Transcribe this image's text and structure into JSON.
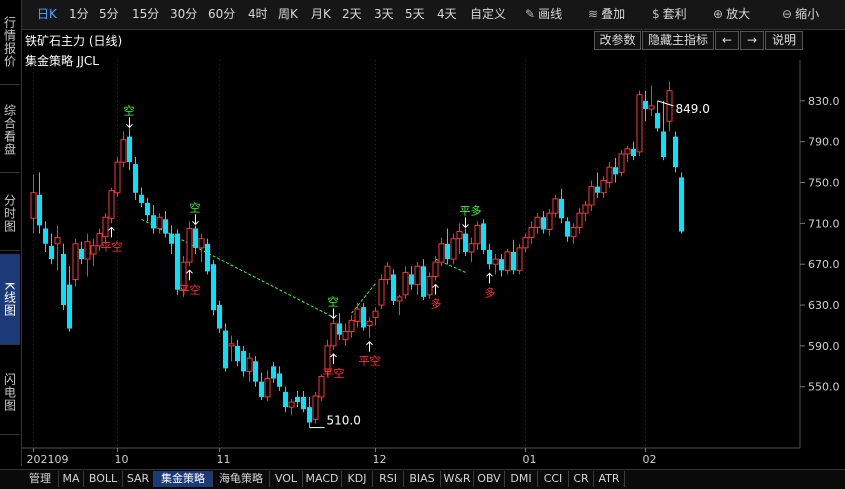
{
  "left_nav": [
    {
      "label": "行情报价",
      "active": false
    },
    {
      "label": "综合看盘",
      "active": false
    },
    {
      "label": "分时图",
      "active": false
    },
    {
      "label": "K线图",
      "active": true
    },
    {
      "label": "闪电图",
      "active": false
    }
  ],
  "toolbar": {
    "periods": [
      "日K",
      "1分",
      "5分",
      "15分",
      "30分",
      "60分",
      "4时",
      "周K",
      "月K",
      "2天",
      "3天",
      "5天",
      "4天",
      "自定义"
    ],
    "active_period": "日K",
    "draw_label": "画线",
    "overlay_label": "叠加",
    "arbitrage_label": "套利",
    "zoom_in_label": "放大",
    "zoom_out_label": "缩小"
  },
  "title": {
    "symbol_name": "铁矿石主力 (日线)",
    "indicator_name": "集金策略 JJCL",
    "change_params": "改参数",
    "hide_main": "隐藏主指标",
    "left_arrow": "←",
    "right_arrow": "→",
    "explain": "说明"
  },
  "bottom_tabs": [
    {
      "label": "管理"
    },
    {
      "label": "MA"
    },
    {
      "label": "BOLL"
    },
    {
      "label": "SAR"
    },
    {
      "label": "集金策略",
      "active": true
    },
    {
      "label": "海龟策略"
    },
    {
      "label": "VOL"
    },
    {
      "label": "MACD"
    },
    {
      "label": "KDJ"
    },
    {
      "label": "RSI"
    },
    {
      "label": "BIAS"
    },
    {
      "label": "W&R"
    },
    {
      "label": "OBV"
    },
    {
      "label": "DMI"
    },
    {
      "label": "CCI"
    },
    {
      "label": "CR"
    },
    {
      "label": "ATR"
    }
  ],
  "colors": {
    "up": "#ff3232",
    "down": "#00e5ff",
    "signal_buy": "#ff3232",
    "signal_sell": "#32ff32",
    "line": "#32ff32"
  },
  "chart_data": {
    "type": "candlestick",
    "ylim": [
      490,
      870
    ],
    "y_ticks": [
      550.0,
      590.0,
      630.0,
      670.0,
      710.0,
      750.0,
      790.0,
      830.0
    ],
    "x_ticks": [
      {
        "label": "202109",
        "index": 0
      },
      {
        "label": "10",
        "index": 14
      },
      {
        "label": "11",
        "index": 31
      },
      {
        "label": "12",
        "index": 57
      },
      {
        "label": "01",
        "index": 82
      },
      {
        "label": "02",
        "index": 102
      }
    ],
    "max_label": {
      "text": "849.0",
      "index": 104
    },
    "min_label": {
      "text": "510.0",
      "index": 46
    },
    "candles": [
      {
        "o": 715,
        "h": 758,
        "l": 700,
        "c": 740
      },
      {
        "o": 738,
        "h": 760,
        "l": 700,
        "c": 708
      },
      {
        "o": 705,
        "h": 712,
        "l": 682,
        "c": 690
      },
      {
        "o": 688,
        "h": 700,
        "l": 670,
        "c": 675
      },
      {
        "o": 690,
        "h": 708,
        "l": 664,
        "c": 696
      },
      {
        "o": 680,
        "h": 690,
        "l": 625,
        "c": 630
      },
      {
        "o": 650,
        "h": 668,
        "l": 604,
        "c": 607
      },
      {
        "o": 655,
        "h": 695,
        "l": 648,
        "c": 690
      },
      {
        "o": 685,
        "h": 692,
        "l": 670,
        "c": 675
      },
      {
        "o": 675,
        "h": 700,
        "l": 658,
        "c": 692
      },
      {
        "o": 680,
        "h": 695,
        "l": 668,
        "c": 688
      },
      {
        "o": 688,
        "h": 705,
        "l": 683,
        "c": 700
      },
      {
        "o": 697,
        "h": 720,
        "l": 690,
        "c": 716
      },
      {
        "o": 715,
        "h": 745,
        "l": 710,
        "c": 742
      },
      {
        "o": 740,
        "h": 775,
        "l": 736,
        "c": 770
      },
      {
        "o": 770,
        "h": 800,
        "l": 765,
        "c": 792
      },
      {
        "o": 795,
        "h": 803,
        "l": 762,
        "c": 770
      },
      {
        "o": 768,
        "h": 775,
        "l": 733,
        "c": 740
      },
      {
        "o": 738,
        "h": 745,
        "l": 726,
        "c": 730
      },
      {
        "o": 730,
        "h": 735,
        "l": 712,
        "c": 718
      },
      {
        "o": 718,
        "h": 728,
        "l": 700,
        "c": 705
      },
      {
        "o": 705,
        "h": 720,
        "l": 700,
        "c": 716
      },
      {
        "o": 714,
        "h": 722,
        "l": 696,
        "c": 700
      },
      {
        "o": 700,
        "h": 708,
        "l": 680,
        "c": 690
      },
      {
        "o": 700,
        "h": 704,
        "l": 640,
        "c": 645
      },
      {
        "o": 645,
        "h": 678,
        "l": 638,
        "c": 672
      },
      {
        "o": 672,
        "h": 712,
        "l": 668,
        "c": 705
      },
      {
        "o": 705,
        "h": 708,
        "l": 680,
        "c": 686
      },
      {
        "o": 686,
        "h": 700,
        "l": 672,
        "c": 695
      },
      {
        "o": 690,
        "h": 695,
        "l": 660,
        "c": 663
      },
      {
        "o": 670,
        "h": 674,
        "l": 620,
        "c": 625
      },
      {
        "o": 630,
        "h": 634,
        "l": 603,
        "c": 607
      },
      {
        "o": 605,
        "h": 612,
        "l": 565,
        "c": 568
      },
      {
        "o": 590,
        "h": 600,
        "l": 575,
        "c": 592
      },
      {
        "o": 590,
        "h": 596,
        "l": 570,
        "c": 575
      },
      {
        "o": 585,
        "h": 590,
        "l": 560,
        "c": 565
      },
      {
        "o": 565,
        "h": 583,
        "l": 555,
        "c": 578
      },
      {
        "o": 575,
        "h": 580,
        "l": 550,
        "c": 555
      },
      {
        "o": 555,
        "h": 564,
        "l": 537,
        "c": 540
      },
      {
        "o": 540,
        "h": 566,
        "l": 536,
        "c": 558
      },
      {
        "o": 570,
        "h": 574,
        "l": 554,
        "c": 558
      },
      {
        "o": 563,
        "h": 570,
        "l": 546,
        "c": 550
      },
      {
        "o": 545,
        "h": 550,
        "l": 525,
        "c": 530
      },
      {
        "o": 530,
        "h": 538,
        "l": 522,
        "c": 535
      },
      {
        "o": 540,
        "h": 546,
        "l": 530,
        "c": 535
      },
      {
        "o": 540,
        "h": 546,
        "l": 525,
        "c": 528
      },
      {
        "o": 530,
        "h": 540,
        "l": 510,
        "c": 515
      },
      {
        "o": 518,
        "h": 545,
        "l": 514,
        "c": 541
      },
      {
        "o": 540,
        "h": 562,
        "l": 536,
        "c": 560
      },
      {
        "o": 565,
        "h": 596,
        "l": 560,
        "c": 590
      },
      {
        "o": 590,
        "h": 616,
        "l": 586,
        "c": 612
      },
      {
        "o": 612,
        "h": 622,
        "l": 596,
        "c": 601
      },
      {
        "o": 596,
        "h": 612,
        "l": 590,
        "c": 604
      },
      {
        "o": 604,
        "h": 620,
        "l": 598,
        "c": 615
      },
      {
        "o": 614,
        "h": 632,
        "l": 608,
        "c": 626
      },
      {
        "o": 628,
        "h": 632,
        "l": 605,
        "c": 608
      },
      {
        "o": 610,
        "h": 618,
        "l": 598,
        "c": 614
      },
      {
        "o": 618,
        "h": 628,
        "l": 610,
        "c": 624
      },
      {
        "o": 630,
        "h": 660,
        "l": 626,
        "c": 655
      },
      {
        "o": 655,
        "h": 672,
        "l": 650,
        "c": 668
      },
      {
        "o": 660,
        "h": 665,
        "l": 630,
        "c": 634
      },
      {
        "o": 634,
        "h": 640,
        "l": 620,
        "c": 638
      },
      {
        "o": 640,
        "h": 668,
        "l": 636,
        "c": 662
      },
      {
        "o": 660,
        "h": 668,
        "l": 645,
        "c": 650
      },
      {
        "o": 650,
        "h": 672,
        "l": 640,
        "c": 668
      },
      {
        "o": 668,
        "h": 675,
        "l": 635,
        "c": 638
      },
      {
        "o": 640,
        "h": 662,
        "l": 636,
        "c": 658
      },
      {
        "o": 658,
        "h": 678,
        "l": 654,
        "c": 672
      },
      {
        "o": 672,
        "h": 696,
        "l": 668,
        "c": 690
      },
      {
        "o": 690,
        "h": 705,
        "l": 670,
        "c": 675
      },
      {
        "o": 675,
        "h": 700,
        "l": 670,
        "c": 695
      },
      {
        "o": 695,
        "h": 710,
        "l": 680,
        "c": 702
      },
      {
        "o": 700,
        "h": 705,
        "l": 678,
        "c": 682
      },
      {
        "o": 682,
        "h": 696,
        "l": 672,
        "c": 690
      },
      {
        "o": 690,
        "h": 712,
        "l": 684,
        "c": 708
      },
      {
        "o": 710,
        "h": 714,
        "l": 680,
        "c": 684
      },
      {
        "o": 684,
        "h": 690,
        "l": 665,
        "c": 670
      },
      {
        "o": 670,
        "h": 680,
        "l": 660,
        "c": 675
      },
      {
        "o": 675,
        "h": 680,
        "l": 658,
        "c": 664
      },
      {
        "o": 664,
        "h": 685,
        "l": 660,
        "c": 682
      },
      {
        "o": 682,
        "h": 694,
        "l": 660,
        "c": 664
      },
      {
        "o": 664,
        "h": 690,
        "l": 660,
        "c": 686
      },
      {
        "o": 686,
        "h": 700,
        "l": 682,
        "c": 696
      },
      {
        "o": 696,
        "h": 712,
        "l": 690,
        "c": 706
      },
      {
        "o": 706,
        "h": 720,
        "l": 700,
        "c": 716
      },
      {
        "o": 716,
        "h": 722,
        "l": 700,
        "c": 704
      },
      {
        "o": 704,
        "h": 724,
        "l": 698,
        "c": 720
      },
      {
        "o": 720,
        "h": 738,
        "l": 716,
        "c": 734
      },
      {
        "o": 734,
        "h": 744,
        "l": 710,
        "c": 715
      },
      {
        "o": 712,
        "h": 716,
        "l": 692,
        "c": 697
      },
      {
        "o": 697,
        "h": 710,
        "l": 690,
        "c": 706
      },
      {
        "o": 706,
        "h": 725,
        "l": 700,
        "c": 720
      },
      {
        "o": 720,
        "h": 732,
        "l": 712,
        "c": 728
      },
      {
        "o": 728,
        "h": 752,
        "l": 722,
        "c": 746
      },
      {
        "o": 746,
        "h": 760,
        "l": 735,
        "c": 740
      },
      {
        "o": 740,
        "h": 756,
        "l": 735,
        "c": 752
      },
      {
        "o": 750,
        "h": 770,
        "l": 745,
        "c": 765
      },
      {
        "o": 765,
        "h": 774,
        "l": 750,
        "c": 758
      },
      {
        "o": 760,
        "h": 782,
        "l": 756,
        "c": 778
      },
      {
        "o": 778,
        "h": 786,
        "l": 770,
        "c": 783
      },
      {
        "o": 783,
        "h": 790,
        "l": 772,
        "c": 776
      },
      {
        "o": 780,
        "h": 840,
        "l": 776,
        "c": 836
      },
      {
        "o": 830,
        "h": 840,
        "l": 810,
        "c": 822
      },
      {
        "o": 822,
        "h": 845,
        "l": 815,
        "c": 825
      },
      {
        "o": 818,
        "h": 830,
        "l": 800,
        "c": 803
      },
      {
        "o": 800,
        "h": 830,
        "l": 772,
        "c": 775
      },
      {
        "o": 810,
        "h": 849,
        "l": 800,
        "c": 840
      },
      {
        "o": 795,
        "h": 800,
        "l": 760,
        "c": 765
      },
      {
        "o": 755,
        "h": 760,
        "l": 700,
        "c": 702
      }
    ],
    "signals": [
      {
        "text": "空",
        "index": 16,
        "type": "sell"
      },
      {
        "text": "平空",
        "index": 13,
        "type": "buy"
      },
      {
        "text": "空",
        "index": 27,
        "type": "sell"
      },
      {
        "text": "平空",
        "index": 26,
        "type": "buy"
      },
      {
        "text": "空",
        "index": 50,
        "type": "sell"
      },
      {
        "text": "平空",
        "index": 50,
        "type": "buy"
      },
      {
        "text": "平空",
        "index": 56,
        "type": "buy"
      },
      {
        "text": "多",
        "index": 67,
        "type": "buy"
      },
      {
        "text": "平多",
        "index": 72,
        "type": "sell"
      },
      {
        "text": "多",
        "index": 76,
        "type": "buy"
      }
    ],
    "dashed_segments": [
      {
        "from": {
          "index": 18,
          "value": 714
        },
        "to": {
          "index": 50,
          "value": 618
        }
      },
      {
        "from": {
          "index": 53,
          "value": 622
        },
        "to": {
          "index": 57,
          "value": 651
        }
      },
      {
        "from": {
          "index": 67,
          "value": 675
        },
        "to": {
          "index": 72,
          "value": 662
        }
      }
    ]
  }
}
